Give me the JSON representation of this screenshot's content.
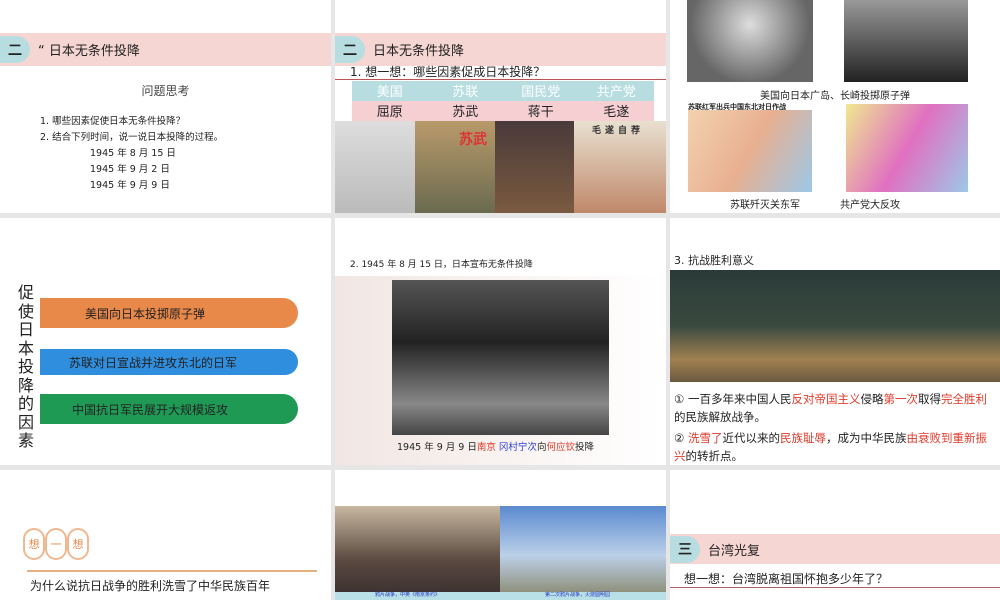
{
  "s1": {
    "num": "二",
    "title": "“ 日本无条件投降",
    "heading": "问题思考",
    "q1": "1.   哪些因素促使日本无条件投降？",
    "q2": "2.   结合下列时间，说一说日本投降的过程。",
    "dates": [
      "1945 年 8 月 15 日",
      "1945 年 9 月 2 日",
      "1945 年 9 月 9 日"
    ]
  },
  "s2": {
    "num": "二",
    "title": "日本无条件投降",
    "question": "1. 想一想：哪些因素促成日本投降？",
    "row1": [
      "美国",
      "苏联",
      "国民党",
      "共产党"
    ],
    "row2": [
      "屈原",
      "苏武",
      "蒋干",
      "毛遂"
    ],
    "img_text": [
      "苏武",
      "毛遂自荐"
    ]
  },
  "s3": {
    "cap1": "美国向日本广岛、长崎投掷原子弹",
    "map1_title": "苏联红军出兵中国东北对日作战",
    "cap2": "苏联歼灭关东军",
    "cap3": "共产党大反攻"
  },
  "s4": {
    "vertical": "促使日本投降的因素",
    "items": [
      "美国向日本投掷原子弹",
      "苏联对日宣战并进攻东北的日军",
      "中国抗日军民展开大规模返攻"
    ],
    "colors": [
      "#e8894a",
      "#2f8ede",
      "#1f9a55"
    ]
  },
  "s5": {
    "title": "2. 1945 年 8 月 15 日，日本宣布无条件投降",
    "cap_a": "1945 年 9 月 9 日",
    "cap_b": "南京",
    "cap_c": "冈村宁次",
    "cap_d": "向",
    "cap_e": "何应钦",
    "cap_f": "投降"
  },
  "s6": {
    "title": "3. 抗战胜利意义",
    "p1": [
      "① 一百多年来中国人民",
      "反对帝国主义",
      "侵略",
      "第一次",
      "取得",
      "完全胜利",
      "的民族解放战争。"
    ],
    "p2": [
      "② ",
      "洗雪了",
      "近代以来的",
      "民族耻辱",
      "，成为中华民族",
      "由衰败到重新振兴",
      "的转折点。"
    ]
  },
  "s7": {
    "badge": [
      "想",
      "一",
      "想"
    ],
    "text": "为什么说抗日战争的胜利洗雪了中华民族百年"
  },
  "s8": {
    "cap1": "鸦片战争，中英《南京条约》",
    "cap2": "第二次鸦片战争，火烧圆明园"
  },
  "s9": {
    "num": "三",
    "title": "台湾光复",
    "question": "想一想：台湾脱离祖国怀抱多少年了？"
  }
}
